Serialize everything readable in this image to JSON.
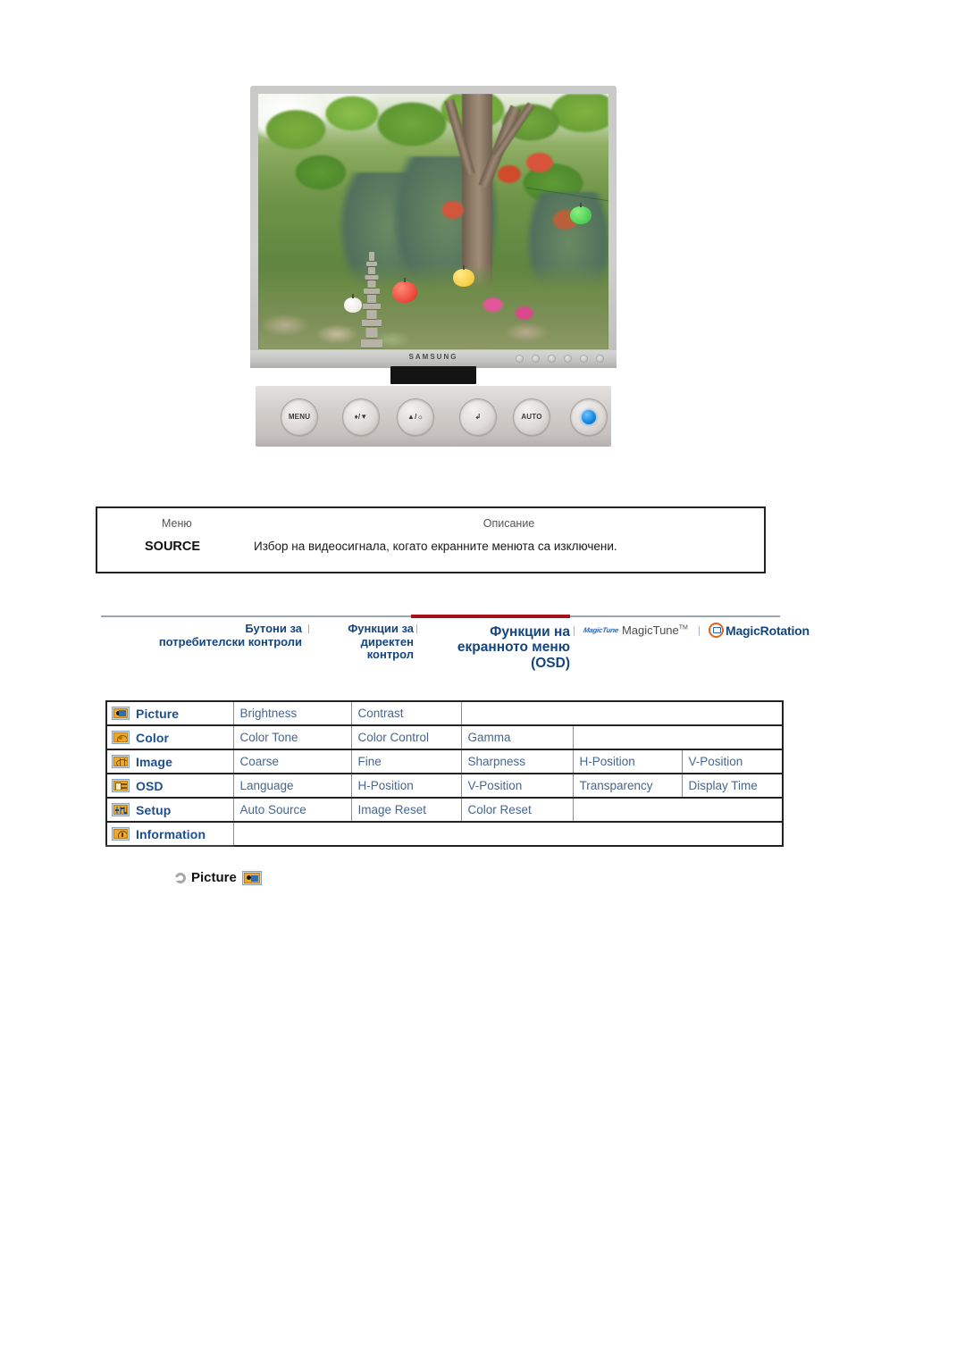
{
  "product": {
    "brand": "SAMSUNG",
    "panel_buttons": [
      {
        "name": "menu-button",
        "label": "MENU"
      },
      {
        "name": "down-volume-button",
        "label": "♦/▼"
      },
      {
        "name": "up-brightness-button",
        "label": "▲/☼"
      },
      {
        "name": "source-enter-button",
        "label": "↲"
      },
      {
        "name": "auto-button",
        "label": "AUTO"
      },
      {
        "name": "power-button",
        "label": ""
      }
    ]
  },
  "source_table": {
    "header_menu": "Меню",
    "header_description": "Описание",
    "row_menu": "SOURCE",
    "row_description": "Избор на видеосигнала, когато екранните менюта са изключени."
  },
  "nav": {
    "accent_color": "#a81117",
    "link_color": "#14457e",
    "separator": "|",
    "tabs": [
      {
        "id": "tab-user-control-buttons",
        "line1": "Бутони за",
        "line2": "потребителски контроли",
        "active": false
      },
      {
        "id": "tab-direct-control-functions",
        "line1": "Функции за",
        "line2": "директен контрол",
        "active": false
      },
      {
        "id": "tab-osd-functions",
        "line1": "Функции на",
        "line2": "екранното меню (OSD)",
        "active": true
      }
    ],
    "magictune": {
      "mark": "MagicTune",
      "label": "MagicTune",
      "trademark": "TM"
    },
    "magicrotation": {
      "label": "MagicRotation"
    }
  },
  "osd_menu": {
    "categories": [
      {
        "icon": "picture-icon",
        "label": "Picture",
        "items": [
          "Brightness",
          "Contrast"
        ]
      },
      {
        "icon": "color-icon",
        "label": "Color",
        "items": [
          "Color Tone",
          "Color Control",
          "Gamma"
        ]
      },
      {
        "icon": "image-icon",
        "label": "Image",
        "items": [
          "Coarse",
          "Fine",
          "Sharpness",
          "H-Position",
          "V-Position"
        ]
      },
      {
        "icon": "osd-icon",
        "label": "OSD",
        "items": [
          "Language",
          "H-Position",
          "V-Position",
          "Transparency",
          "Display Time"
        ]
      },
      {
        "icon": "setup-icon",
        "label": "Setup",
        "items": [
          "Auto Source",
          "Image Reset",
          "Color Reset"
        ]
      },
      {
        "icon": "information-icon",
        "label": "Information",
        "items": []
      }
    ]
  },
  "section_heading": {
    "label": "Picture",
    "icon": "picture-icon"
  }
}
